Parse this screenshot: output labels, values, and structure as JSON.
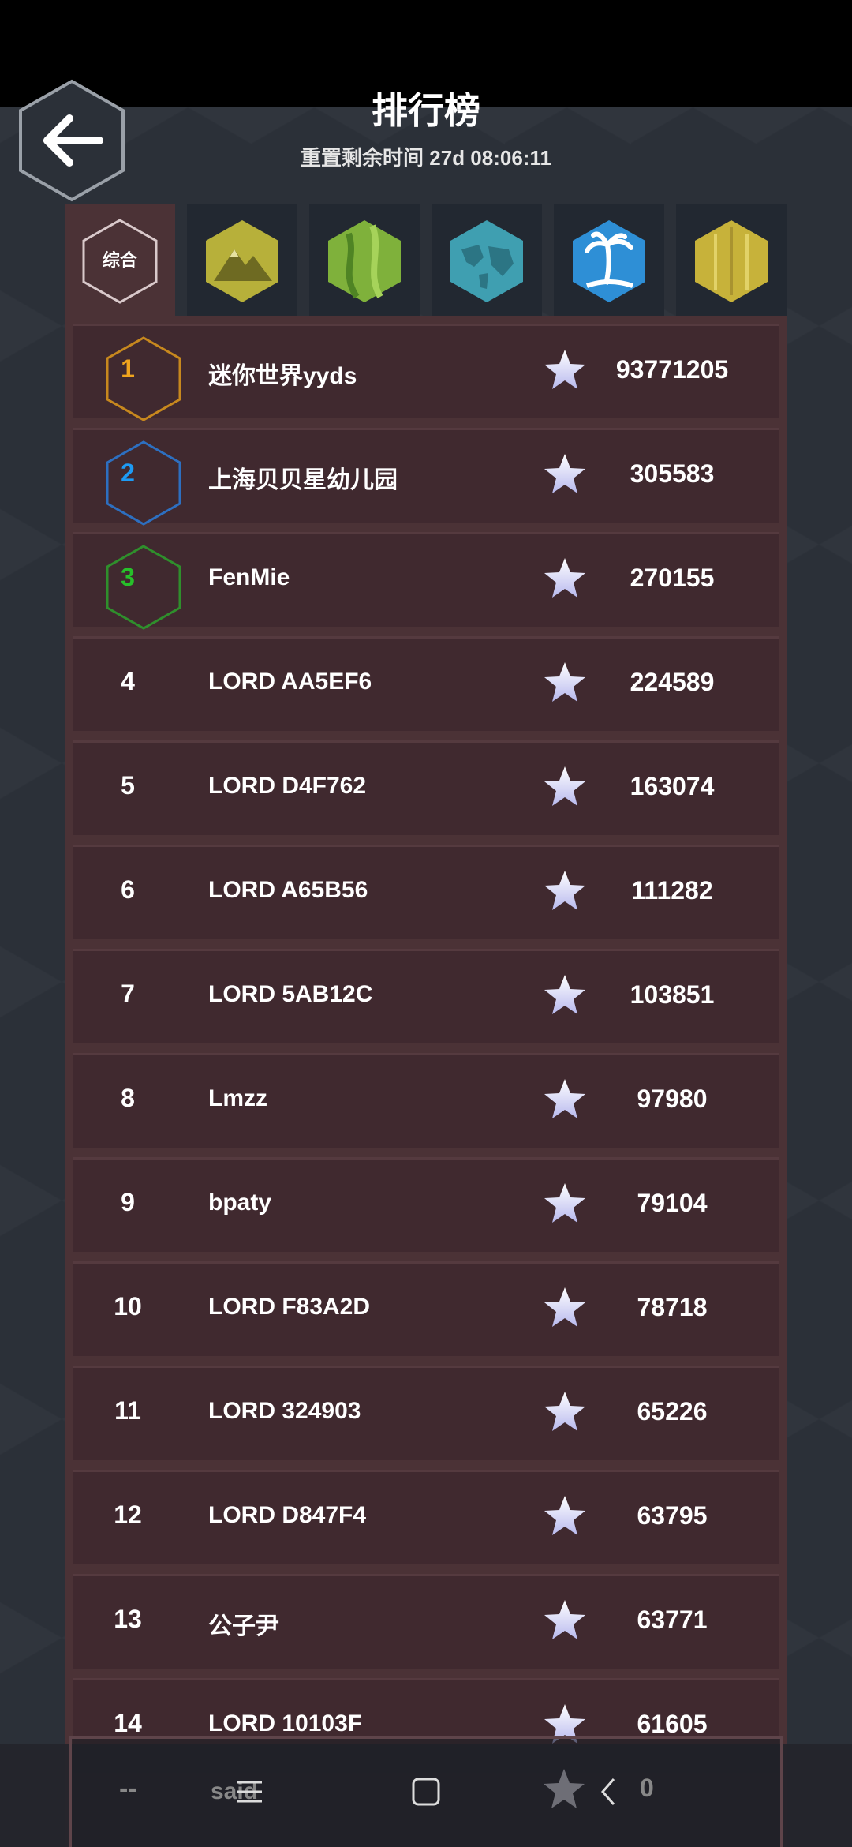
{
  "header": {
    "title": "排行榜",
    "subtitle": "重置剩余时间 27d 08:06:11",
    "back_icon": "arrow-left-icon"
  },
  "tabs": [
    {
      "label": "综合",
      "icon": "hexagon-outline",
      "active": true
    },
    {
      "label": "",
      "icon": "mountain-icon",
      "color": "#b7b03a"
    },
    {
      "label": "",
      "icon": "grassland-icon",
      "color": "#7fb13b"
    },
    {
      "label": "",
      "icon": "world-map-icon",
      "color": "#3f9fb1"
    },
    {
      "label": "",
      "icon": "palm-island-icon",
      "color": "#2e8fd6"
    },
    {
      "label": "",
      "icon": "gold-texture-icon",
      "color": "#c7b23a"
    }
  ],
  "leaderboard": [
    {
      "rank": "1",
      "name": "迷你世界yyds",
      "score": "93771205",
      "badge_color": "#c7881e",
      "rank_color": "#f0a41e"
    },
    {
      "rank": "2",
      "name": "上海贝贝星幼儿园",
      "score": "305583",
      "badge_color": "#2d6fc0",
      "rank_color": "#1d9bf5"
    },
    {
      "rank": "3",
      "name": "FenMie",
      "score": "270155",
      "badge_color": "#2f8f2c",
      "rank_color": "#27c02a"
    },
    {
      "rank": "4",
      "name": "LORD AA5EF6",
      "score": "224589"
    },
    {
      "rank": "5",
      "name": "LORD D4F762",
      "score": "163074"
    },
    {
      "rank": "6",
      "name": "LORD A65B56",
      "score": "111282"
    },
    {
      "rank": "7",
      "name": "LORD 5AB12C",
      "score": "103851"
    },
    {
      "rank": "8",
      "name": "Lmzz",
      "score": "97980"
    },
    {
      "rank": "9",
      "name": "bpaty",
      "score": "79104"
    },
    {
      "rank": "10",
      "name": "LORD F83A2D",
      "score": "78718"
    },
    {
      "rank": "11",
      "name": "LORD 324903",
      "score": "65226"
    },
    {
      "rank": "12",
      "name": "LORD D847F4",
      "score": "63795"
    },
    {
      "rank": "13",
      "name": "公子尹",
      "score": "63771"
    },
    {
      "rank": "14",
      "name": "LORD 10103F",
      "score": "61605"
    }
  ],
  "my_entry": {
    "rank": "--",
    "name": "said",
    "score": "0"
  },
  "nav": {
    "menu_icon": "menu-icon",
    "home_icon": "square-home-icon",
    "back_icon": "chevron-left-icon"
  }
}
